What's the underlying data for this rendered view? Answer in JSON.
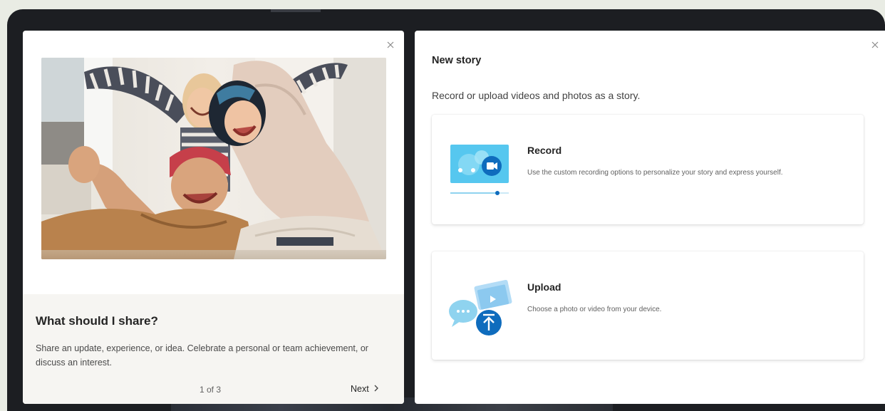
{
  "intro": {
    "title": "What should I share?",
    "description": "Share an update, experience, or idea. Celebrate a personal or team achievement, or discuss an interest.",
    "pager": "1 of 3",
    "next_label": "Next"
  },
  "new_story": {
    "title": "New story",
    "subtitle": "Record or upload videos and photos as a story.",
    "options": [
      {
        "title": "Record",
        "description": "Use the custom recording options to personalize your story and express yourself.",
        "icon": "record-video-icon"
      },
      {
        "title": "Upload",
        "description": "Choose a photo or video from your device.",
        "icon": "upload-media-icon"
      }
    ]
  },
  "colors": {
    "accent": "#0f6cbd",
    "icon_light_blue": "#56c7ef",
    "panel_bg": "#ffffff",
    "backdrop": "#1c1e22"
  }
}
